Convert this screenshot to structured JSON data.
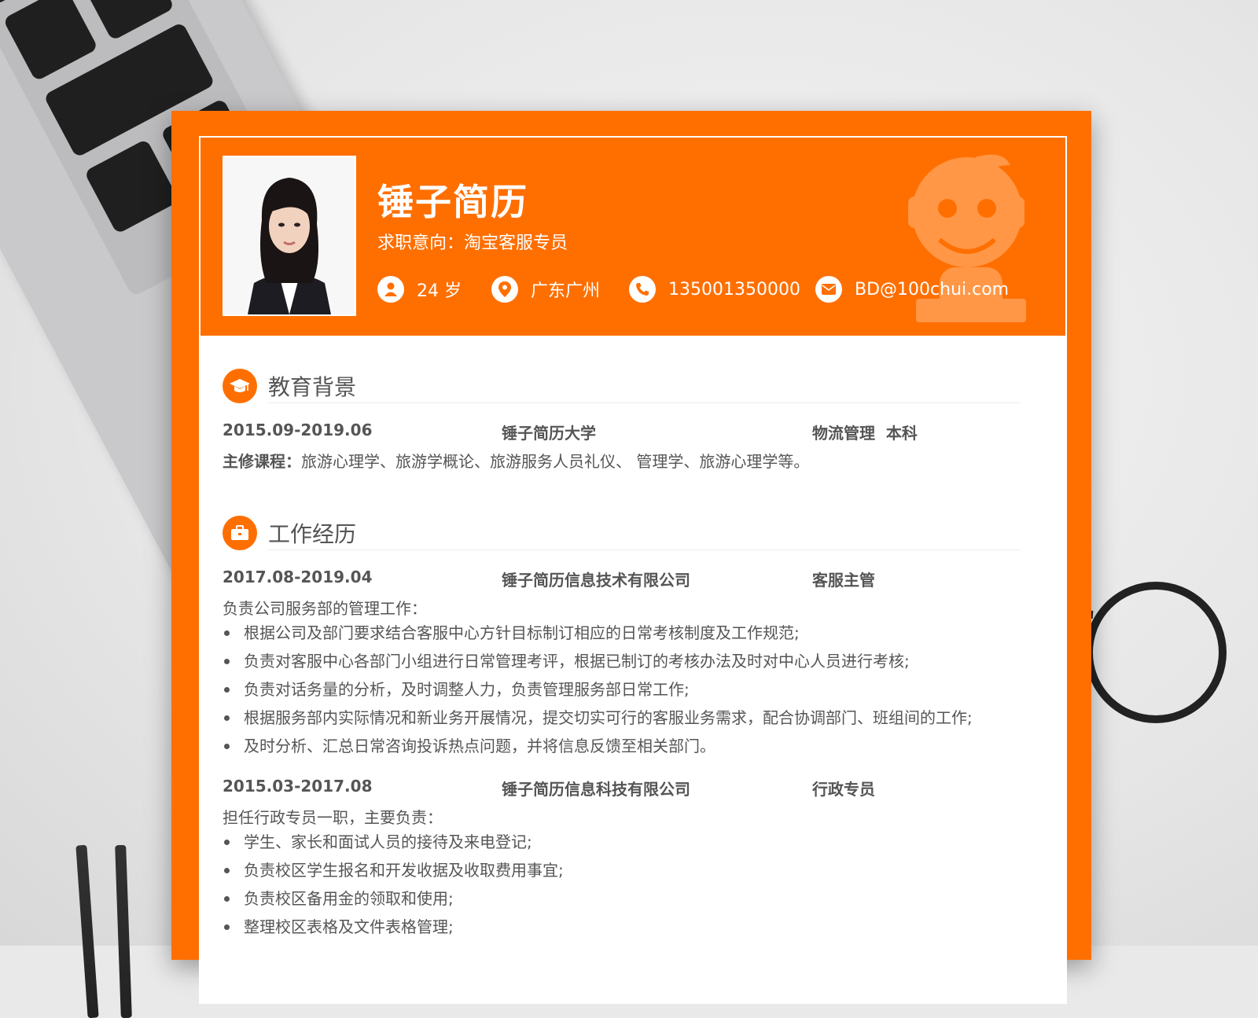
{
  "header": {
    "name": "锤子简历",
    "intent": "求职意向：淘宝客服专员",
    "age": "24 岁",
    "location": "广东广州",
    "phone": "135001350000",
    "email": "BD@100chui.com"
  },
  "colors": {
    "accent": "#ff6f00",
    "text": "#555555"
  },
  "education": {
    "title": "教育背景",
    "period": "2015.09-2019.06",
    "school": "锤子简历大学",
    "major": "物流管理  本科",
    "courses_label": "主修课程：",
    "courses": "旅游心理学、旅游学概论、旅游服务人员礼仪、 管理学、旅游心理学等。"
  },
  "work": {
    "title": "工作经历",
    "jobs": [
      {
        "period": "2017.08-2019.04",
        "company": "锤子简历信息技术有限公司",
        "role": "客服主管",
        "intro": "负责公司服务部的管理工作：",
        "items": [
          "根据公司及部门要求结合客服中心方针目标制订相应的日常考核制度及工作规范;",
          "负责对客服中心各部门小组进行日常管理考评，根据已制订的考核办法及时对中心人员进行考核;",
          "负责对话务量的分析，及时调整人力，负责管理服务部日常工作;",
          "根据服务部内实际情况和新业务开展情况，提交切实可行的客服业务需求，配合协调部门、班组间的工作;",
          "及时分析、汇总日常咨询投诉热点问题，并将信息反馈至相关部门。"
        ]
      },
      {
        "period": "2015.03-2017.08",
        "company": "锤子简历信息科技有限公司",
        "role": "行政专员",
        "intro": "担任行政专员一职，主要负责：",
        "items": [
          "学生、家长和面试人员的接待及来电登记;",
          "负责校区学生报名和开发收据及收取费用事宜;",
          "负责校区备用金的领取和使用;",
          "整理校区表格及文件表格管理;"
        ]
      }
    ]
  }
}
